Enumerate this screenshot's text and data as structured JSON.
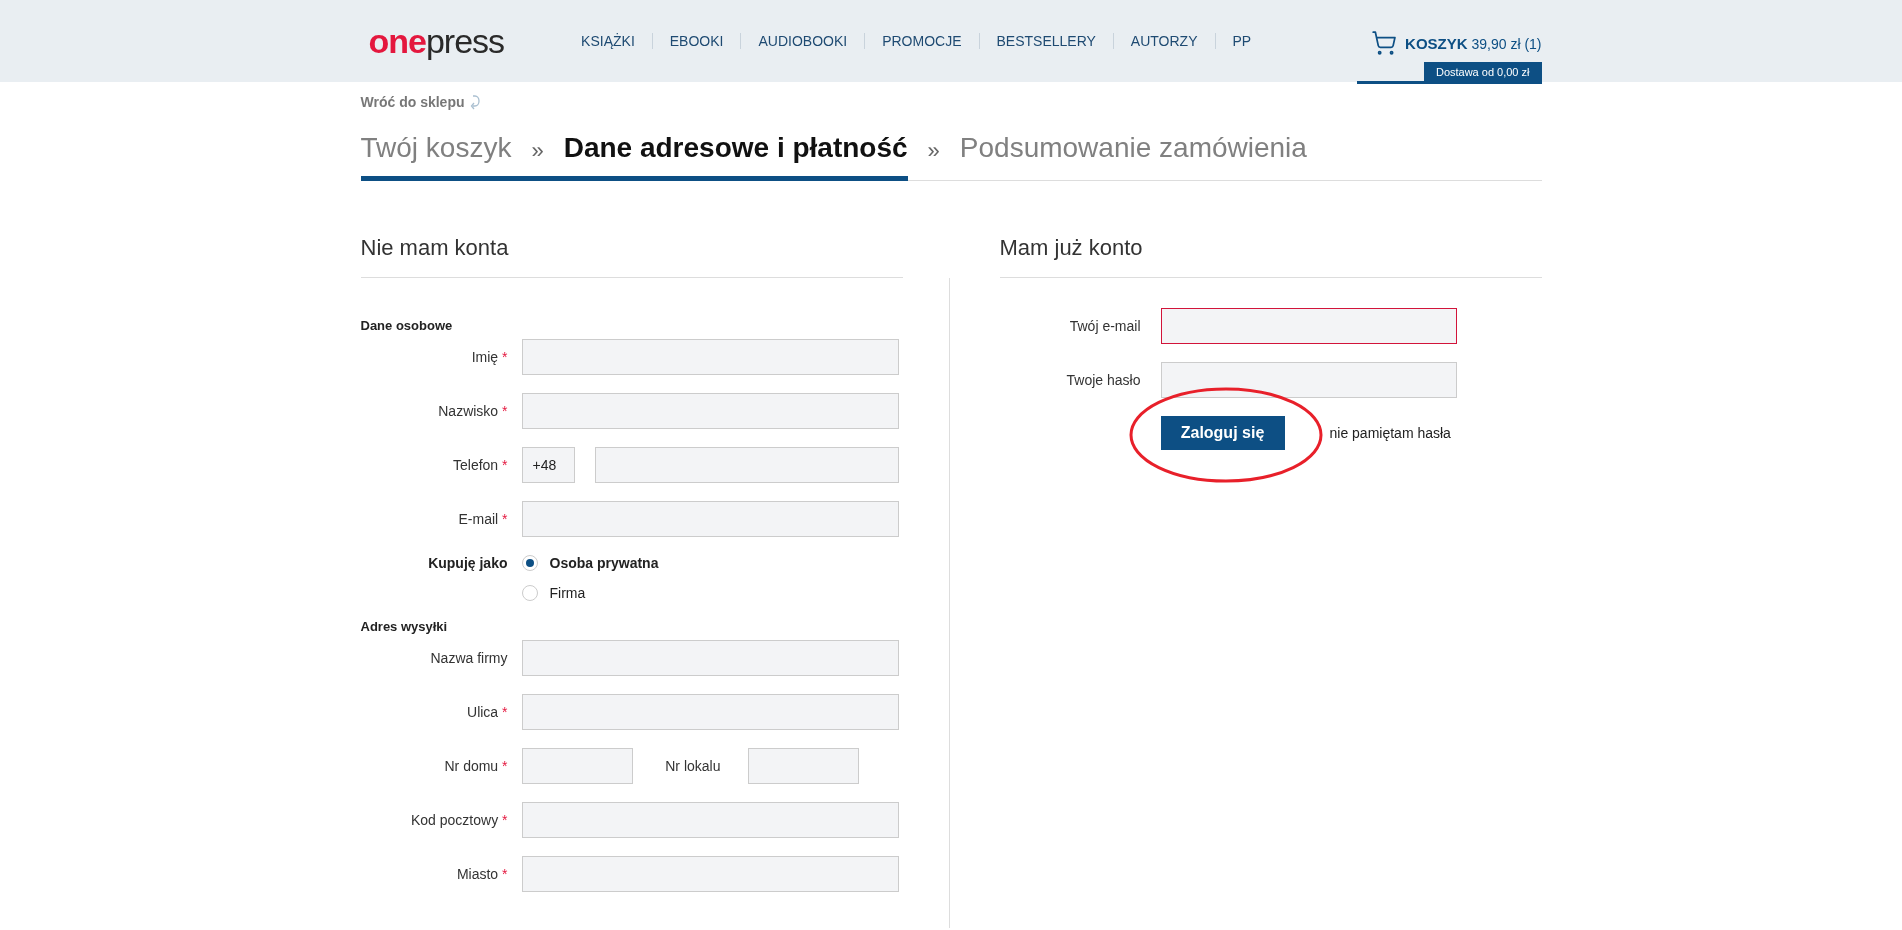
{
  "header": {
    "logo": {
      "first": "one",
      "second": "press"
    },
    "nav": [
      "KSIĄŻKI",
      "EBOOKI",
      "AUDIOBOOKI",
      "PROMOCJE",
      "BESTSELLERY",
      "AUTORZY",
      "PP"
    ],
    "cart": {
      "label": "KOSZYK",
      "price": "39,90 zł (1)",
      "delivery": "Dostawa od 0,00 zł"
    }
  },
  "back_link": "Wróć do sklepu",
  "steps": [
    {
      "kind": "step",
      "label": "Twój koszyk",
      "selected": false,
      "completed": true
    },
    {
      "kind": "separator",
      "label": "»"
    },
    {
      "kind": "step",
      "label": "Dane adresowe i płatność",
      "selected": true,
      "completed": false
    },
    {
      "kind": "separator",
      "label": "»"
    },
    {
      "kind": "step",
      "label": "Podsumowanie zamówienia",
      "selected": false,
      "completed": false
    }
  ],
  "register": {
    "title": "Nie mam konta",
    "groups": [
      {
        "title": "Dane osobowe",
        "fields": [
          {
            "kind": "text",
            "label": "Imię",
            "required_mark": "*"
          },
          {
            "kind": "text",
            "label": "Nazwisko",
            "required_mark": "*"
          },
          {
            "kind": "phone",
            "label": "Telefon",
            "required_mark": "*",
            "prefix": "+48"
          },
          {
            "kind": "text",
            "label": "E-mail",
            "required_mark": "*"
          },
          {
            "kind": "radio",
            "label": "Kupuję jako",
            "options": [
              {
                "label": "Osoba prywatna",
                "selected": true
              },
              {
                "label": "Firma",
                "selected": false
              }
            ]
          }
        ]
      },
      {
        "title": "Adres wysyłki",
        "fields": [
          {
            "kind": "text",
            "label": "Nazwa firmy"
          },
          {
            "kind": "text",
            "label": "Ulica",
            "required_mark": "*"
          },
          {
            "kind": "pair",
            "label": "Nr domu",
            "required_mark": "*",
            "second_label": "Nr lokalu"
          },
          {
            "kind": "text",
            "label": "Kod pocztowy",
            "required_mark": "*"
          },
          {
            "kind": "text",
            "label": "Miasto",
            "required_mark": "*"
          }
        ]
      }
    ]
  },
  "login": {
    "title": "Mam już konto",
    "fields": [
      {
        "label": "Twój e-mail",
        "invalid": true
      },
      {
        "label": "Twoje hasło",
        "invalid": false
      }
    ],
    "button": "Zaloguj się",
    "forgot_link": "nie pamiętam hasła"
  }
}
